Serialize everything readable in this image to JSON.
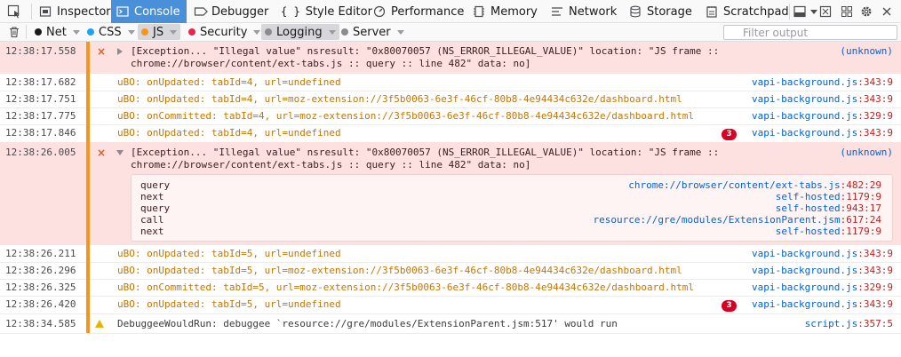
{
  "toolbar": {
    "tabs": [
      {
        "label": "Inspector",
        "icon": "inspector-icon"
      },
      {
        "label": "Console",
        "icon": "console-icon",
        "active": true
      },
      {
        "label": "Debugger",
        "icon": "debugger-icon"
      },
      {
        "label": "Style Editor",
        "icon": "style-editor-icon"
      },
      {
        "label": "Performance",
        "icon": "performance-icon"
      },
      {
        "label": "Memory",
        "icon": "memory-icon"
      },
      {
        "label": "Network",
        "icon": "network-icon"
      },
      {
        "label": "Storage",
        "icon": "storage-icon"
      },
      {
        "label": "Scratchpad",
        "icon": "scratchpad-icon"
      }
    ]
  },
  "filters": {
    "buttons": [
      {
        "label": "Net",
        "color": "#1a1a1a"
      },
      {
        "label": "CSS",
        "color": "#16a6f5"
      },
      {
        "label": "JS",
        "color": "#f7941d",
        "active": true
      },
      {
        "label": "Security",
        "color": "#e22850"
      },
      {
        "label": "Logging",
        "color": "#8c8c90",
        "active": true
      },
      {
        "label": "Server",
        "color": "#8c8c90"
      }
    ],
    "placeholder": "Filter output"
  },
  "messages": [
    {
      "time": "12:38:17.558",
      "type": "error",
      "line1": "[Exception... \"Illegal value\"  nsresult: \"0x80070057 (NS_ERROR_ILLEGAL_VALUE)\"  location: \"JS frame ::",
      "line2": "chrome://browser/content/ext-tabs.js :: query :: line 482\"  data: no]",
      "source": "(unknown)"
    },
    {
      "time": "12:38:17.682",
      "type": "log",
      "text": "uBO: onUpdated: tabId=4, url=undefined",
      "source_file": "vapi-background.js",
      "source_line": ":343:9"
    },
    {
      "time": "12:38:17.751",
      "type": "log",
      "text": "uBO: onUpdated: tabId=4, url=moz-extension://3f5b0063-6e3f-46cf-80b8-4e94434c632e/dashboard.html",
      "source_file": "vapi-background.js",
      "source_line": ":343:9"
    },
    {
      "time": "12:38:17.775",
      "type": "log",
      "text": "uBO: onCommitted: tabId=4, url=moz-extension://3f5b0063-6e3f-46cf-80b8-4e94434c632e/dashboard.html",
      "source_file": "vapi-background.js",
      "source_line": ":329:9"
    },
    {
      "time": "12:38:17.846",
      "type": "log",
      "text": "uBO: onUpdated: tabId=4, url=undefined",
      "repeat": "3",
      "source_file": "vapi-background.js",
      "source_line": ":343:9"
    },
    {
      "time": "12:38:26.005",
      "type": "error",
      "line1": "[Exception... \"Illegal value\"  nsresult: \"0x80070057 (NS_ERROR_ILLEGAL_VALUE)\"  location: \"JS frame ::",
      "line2": "chrome://browser/content/ext-tabs.js :: query :: line 482\"  data: no]",
      "source": "(unknown)"
    },
    {
      "time": "12:38:26.211",
      "type": "log",
      "text": "uBO: onUpdated: tabId=5, url=undefined",
      "source_file": "vapi-background.js",
      "source_line": ":343:9"
    },
    {
      "time": "12:38:26.296",
      "type": "log",
      "text": "uBO: onUpdated: tabId=5, url=moz-extension://3f5b0063-6e3f-46cf-80b8-4e94434c632e/dashboard.html",
      "source_file": "vapi-background.js",
      "source_line": ":343:9"
    },
    {
      "time": "12:38:26.325",
      "type": "log",
      "text": "uBO: onCommitted: tabId=5, url=moz-extension://3f5b0063-6e3f-46cf-80b8-4e94434c632e/dashboard.html",
      "source_file": "vapi-background.js",
      "source_line": ":329:9"
    },
    {
      "time": "12:38:26.420",
      "type": "log",
      "text": "uBO: onUpdated: tabId=5, url=undefined",
      "repeat": "3",
      "source_file": "vapi-background.js",
      "source_line": ":343:9"
    },
    {
      "time": "12:38:34.585",
      "type": "warning",
      "text": "DebuggeeWouldRun: debuggee `resource://gre/modules/ExtensionParent.jsm:517' would run",
      "source_file": "script.js",
      "source_line": ":357:5"
    }
  ],
  "stacktrace": [
    {
      "fn": "query",
      "file": "chrome://browser/content/ext-tabs.js",
      "line": ":482:29"
    },
    {
      "fn": "next",
      "file": "self-hosted",
      "line": ":1179:9"
    },
    {
      "fn": "query",
      "file": "self-hosted",
      "line": ":943:17"
    },
    {
      "fn": "call",
      "file": "resource://gre/modules/ExtensionParent.jsm",
      "line": ":617:24"
    },
    {
      "fn": "next",
      "file": "self-hosted",
      "line": ":1179:9"
    }
  ],
  "colors": {
    "error_bg": "#fde0e0",
    "accent": "#4a90d9",
    "log_text": "#c87500",
    "link": "#0060df",
    "line_number": "#c41e1e"
  }
}
